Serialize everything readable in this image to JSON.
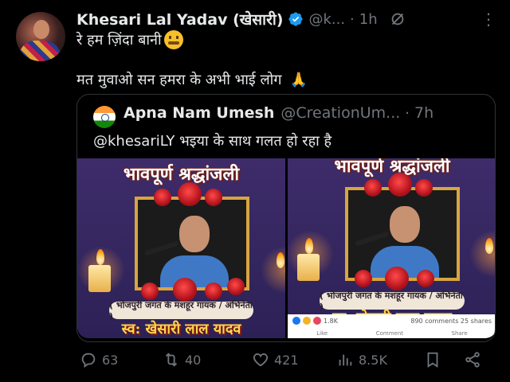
{
  "tweet": {
    "author_name": "Khesari Lal Yadav (खेसारी)",
    "handle": "@k...",
    "separator": "·",
    "time": "1h",
    "more_label": "⋮",
    "line1": "रे हम ज़िंदा बानी",
    "line2": "मत मुवाओ सन हमरा के अभी भाई लोग",
    "pray_emoji": "🙏"
  },
  "quote": {
    "author_name": "Apna Nam Umesh",
    "handle": "@CreationUm...",
    "separator": "·",
    "time": "7h",
    "text": "@khesariLY भइया के साथ गलत हो रहा है",
    "images": [
      {
        "banner": "भावपूर्ण श्रद्धांजली",
        "subtitle": "( भोजपुरी जगत के मशहूर गायक / अभिनेता )",
        "bottom": "स्व: खेसारी लाल यादव"
      },
      {
        "banner": "भावपूर्ण श्रद्धांजली",
        "subtitle": "( भोजपुरी जगत के मशहूर गायक / अभिनेता )",
        "bottom": "स्व: खेसारी लाल यादव",
        "fb_reactions": "1.8K",
        "fb_comments": "890 comments",
        "fb_shares": "25 shares",
        "fb_like": "Like",
        "fb_comment": "Comment",
        "fb_share": "Share"
      }
    ]
  },
  "actions": {
    "replies": "63",
    "reposts": "40",
    "likes": "421",
    "views": "8.5K"
  },
  "colors": {
    "background": "#000000",
    "text": "#e7e9ea",
    "muted": "#71767b",
    "border": "#2f3336",
    "verified": "#1d9bf0"
  },
  "icons": [
    "reply-icon",
    "repost-icon",
    "like-icon",
    "views-icon",
    "bookmark-icon",
    "share-icon",
    "verified-icon",
    "grok-icon",
    "more-icon",
    "pray-emoji",
    "thinking-emoji"
  ]
}
